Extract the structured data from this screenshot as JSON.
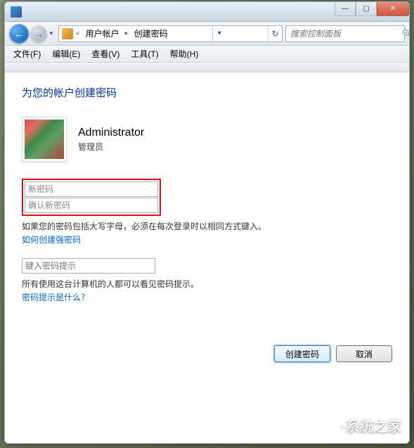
{
  "titlebar": {
    "minimize": "—",
    "maximize": "▢",
    "close": "✕"
  },
  "nav": {
    "back_glyph": "←",
    "forward_glyph": "→",
    "history_drop": "▼",
    "refresh_glyph": "↻",
    "drop_glyph": "▾"
  },
  "breadcrumb": {
    "sep_root": "«",
    "item1": "用户帐户",
    "sep": "▸",
    "item2": "创建密码"
  },
  "search": {
    "placeholder": "搜索控制面板",
    "icon": "🔍"
  },
  "menu": {
    "file": "文件(F)",
    "edit": "编辑(E)",
    "view": "查看(V)",
    "tools": "工具(T)",
    "help": "帮助(H)"
  },
  "page": {
    "heading": "为您的帐户创建密码",
    "account_name": "Administrator",
    "account_type": "管理员",
    "new_password_placeholder": "新密码",
    "confirm_password_placeholder": "确认新密码",
    "caps_note": "如果您的密码包括大写字母，必须在每次登录时以相同方式键入。",
    "strong_link": "如何创建强密码",
    "hint_placeholder": "键入密码提示",
    "hint_note": "所有使用这台计算机的人都可以看见密码提示。",
    "hint_link": "密码提示是什么？",
    "create_btn": "创建密码",
    "cancel_btn": "取消"
  },
  "watermark": {
    "text": "·系统之家"
  }
}
